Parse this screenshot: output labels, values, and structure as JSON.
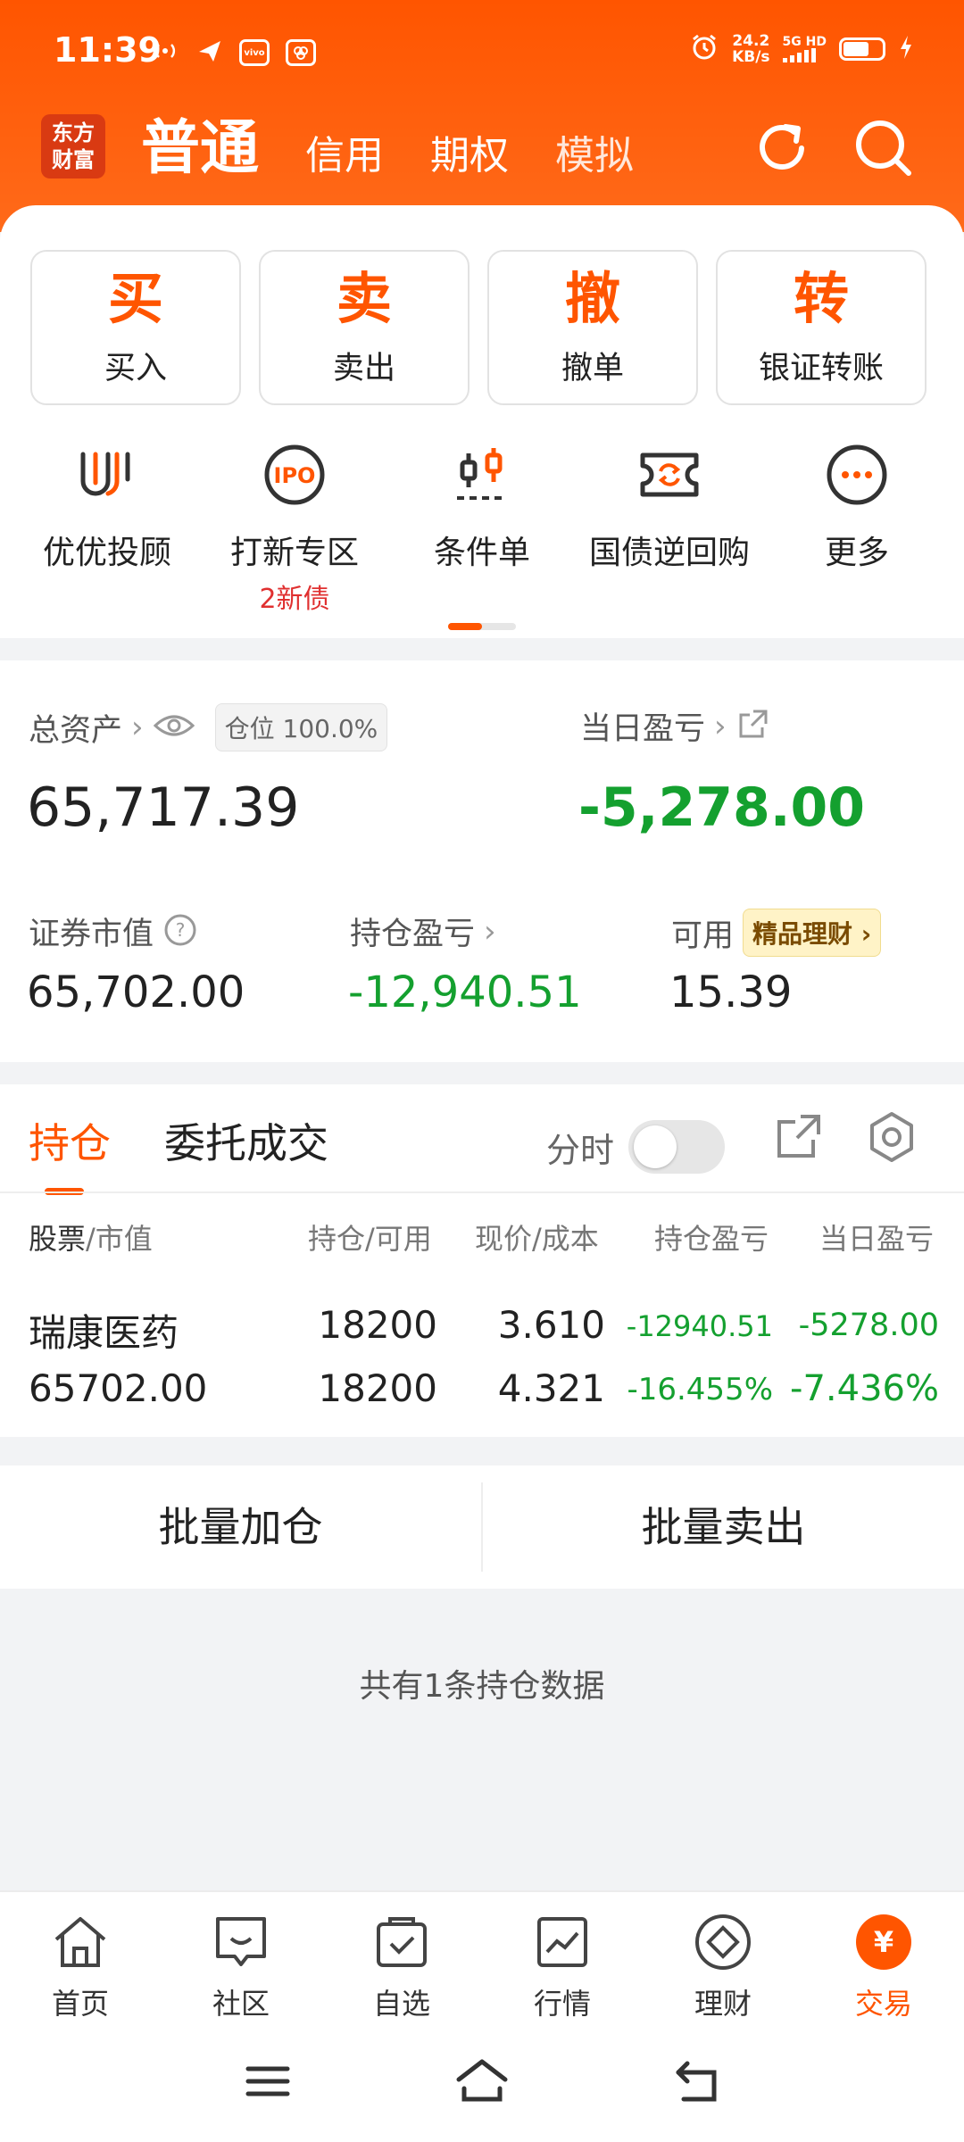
{
  "status_bar": {
    "time": "11:39",
    "speed_value": "24.2",
    "speed_unit": "KB/s",
    "network": "5G HD",
    "vivo": "vivo"
  },
  "header": {
    "logo_line1": "东方",
    "logo_line2": "财富",
    "tabs": [
      "普通",
      "信用",
      "期权",
      "模拟"
    ],
    "accent": "#ff5500"
  },
  "actions": [
    {
      "big": "买",
      "label": "买入"
    },
    {
      "big": "卖",
      "label": "卖出"
    },
    {
      "big": "撤",
      "label": "撤单"
    },
    {
      "big": "转",
      "label": "银证转账"
    }
  ],
  "services": [
    {
      "icon": "youyou-icon",
      "label": "优优投顾"
    },
    {
      "icon": "ipo-icon",
      "label": "打新专区",
      "badge": "2新债"
    },
    {
      "icon": "candlestick-icon",
      "label": "条件单"
    },
    {
      "icon": "repo-icon",
      "label": "国债逆回购"
    },
    {
      "icon": "more-icon",
      "label": "更多"
    }
  ],
  "assets": {
    "total_label": "总资产",
    "position_ratio": "仓位 100.0%",
    "total_value": "65,717.39",
    "day_pnl_label": "当日盈亏",
    "day_pnl_value": "-5,278.00",
    "market_value_label": "证券市值",
    "market_value": "65,702.00",
    "hold_pnl_label": "持仓盈亏",
    "hold_pnl_value": "-12,940.51",
    "available_label": "可用",
    "wealth_tag": "精品理财",
    "available_value": "15.39"
  },
  "positions": {
    "tabs": [
      "持仓",
      "委托成交"
    ],
    "toggle_label": "分时",
    "headers": {
      "stock": "股票",
      "market": "/市值",
      "hold": "持仓/可用",
      "price": "现价/成本",
      "hold_pnl": "持仓盈亏",
      "day_pnl": "当日盈亏"
    },
    "rows": [
      {
        "name": "瑞康医药",
        "market_value": "65702.00",
        "hold": "18200",
        "available": "18200",
        "price": "3.610",
        "cost": "4.321",
        "hold_pnl": "-12940.51",
        "hold_pnl_pct": "-16.455%",
        "day_pnl": "-5278.00",
        "day_pnl_pct": "-7.436%"
      }
    ]
  },
  "batch": {
    "add": "批量加仓",
    "sell": "批量卖出"
  },
  "count_text": "共有1条持仓数据",
  "nav": [
    {
      "icon": "home-icon",
      "label": "首页"
    },
    {
      "icon": "community-icon",
      "label": "社区"
    },
    {
      "icon": "watchlist-icon",
      "label": "自选"
    },
    {
      "icon": "market-icon",
      "label": "行情"
    },
    {
      "icon": "wealth-icon",
      "label": "理财"
    },
    {
      "icon": "trade-icon",
      "label": "交易",
      "glyph": "¥"
    }
  ]
}
